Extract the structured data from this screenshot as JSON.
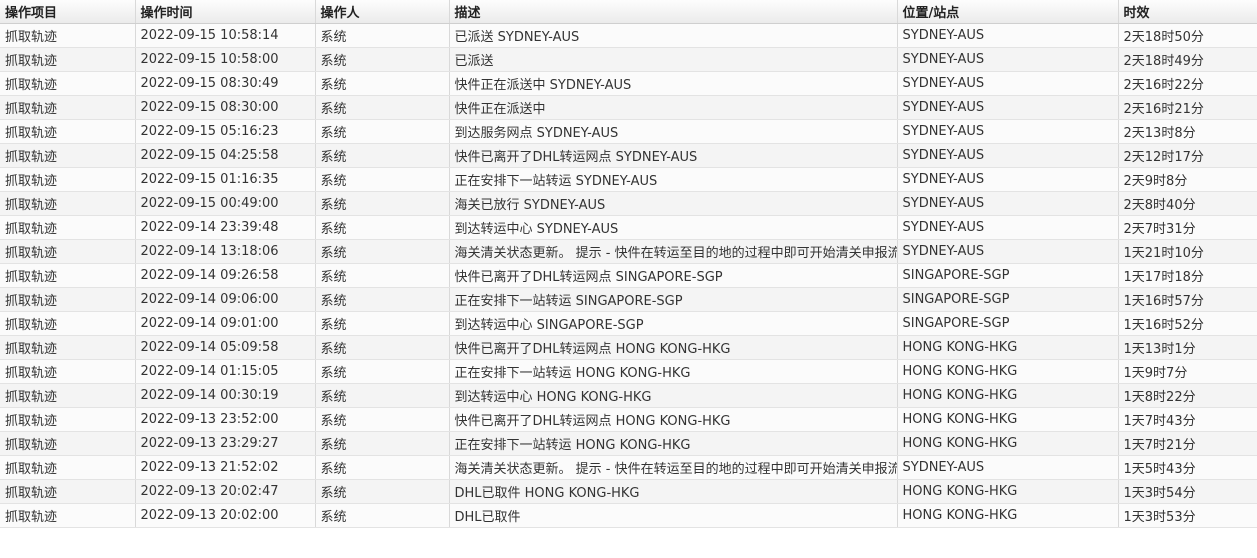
{
  "table": {
    "headers": [
      "操作项目",
      "操作时间",
      "操作人",
      "描述",
      "位置/站点",
      "时效"
    ],
    "rows": [
      [
        "抓取轨迹",
        "2022-09-15 10:58:14",
        "系统",
        "已派送 SYDNEY-AUS",
        "SYDNEY-AUS",
        "2天18时50分"
      ],
      [
        "抓取轨迹",
        "2022-09-15 10:58:00",
        "系统",
        "已派送",
        "SYDNEY-AUS",
        "2天18时49分"
      ],
      [
        "抓取轨迹",
        "2022-09-15 08:30:49",
        "系统",
        "快件正在派送中 SYDNEY-AUS",
        "SYDNEY-AUS",
        "2天16时22分"
      ],
      [
        "抓取轨迹",
        "2022-09-15 08:30:00",
        "系统",
        "快件正在派送中",
        "SYDNEY-AUS",
        "2天16时21分"
      ],
      [
        "抓取轨迹",
        "2022-09-15 05:16:23",
        "系统",
        "到达服务网点 SYDNEY-AUS",
        "SYDNEY-AUS",
        "2天13时8分"
      ],
      [
        "抓取轨迹",
        "2022-09-15 04:25:58",
        "系统",
        "快件已离开了DHL转运网点 SYDNEY-AUS",
        "SYDNEY-AUS",
        "2天12时17分"
      ],
      [
        "抓取轨迹",
        "2022-09-15 01:16:35",
        "系统",
        "正在安排下一站转运 SYDNEY-AUS",
        "SYDNEY-AUS",
        "2天9时8分"
      ],
      [
        "抓取轨迹",
        "2022-09-15 00:49:00",
        "系统",
        "海关已放行 SYDNEY-AUS",
        "SYDNEY-AUS",
        "2天8时40分"
      ],
      [
        "抓取轨迹",
        "2022-09-14 23:39:48",
        "系统",
        "到达转运中心 SYDNEY-AUS",
        "SYDNEY-AUS",
        "2天7时31分"
      ],
      [
        "抓取轨迹",
        "2022-09-14 13:18:06",
        "系统",
        "海关清关状态更新。 提示 - 快件在转运至目的地的过程中即可开始清关申报流程",
        "SYDNEY-AUS",
        "1天21时10分"
      ],
      [
        "抓取轨迹",
        "2022-09-14 09:26:58",
        "系统",
        "快件已离开了DHL转运网点 SINGAPORE-SGP",
        "SINGAPORE-SGP",
        "1天17时18分"
      ],
      [
        "抓取轨迹",
        "2022-09-14 09:06:00",
        "系统",
        "正在安排下一站转运 SINGAPORE-SGP",
        "SINGAPORE-SGP",
        "1天16时57分"
      ],
      [
        "抓取轨迹",
        "2022-09-14 09:01:00",
        "系统",
        "到达转运中心 SINGAPORE-SGP",
        "SINGAPORE-SGP",
        "1天16时52分"
      ],
      [
        "抓取轨迹",
        "2022-09-14 05:09:58",
        "系统",
        "快件已离开了DHL转运网点 HONG KONG-HKG",
        "HONG KONG-HKG",
        "1天13时1分"
      ],
      [
        "抓取轨迹",
        "2022-09-14 01:15:05",
        "系统",
        "正在安排下一站转运 HONG KONG-HKG",
        "HONG KONG-HKG",
        "1天9时7分"
      ],
      [
        "抓取轨迹",
        "2022-09-14 00:30:19",
        "系统",
        "到达转运中心 HONG KONG-HKG",
        "HONG KONG-HKG",
        "1天8时22分"
      ],
      [
        "抓取轨迹",
        "2022-09-13 23:52:00",
        "系统",
        "快件已离开了DHL转运网点 HONG KONG-HKG",
        "HONG KONG-HKG",
        "1天7时43分"
      ],
      [
        "抓取轨迹",
        "2022-09-13 23:29:27",
        "系统",
        "正在安排下一站转运 HONG KONG-HKG",
        "HONG KONG-HKG",
        "1天7时21分"
      ],
      [
        "抓取轨迹",
        "2022-09-13 21:52:02",
        "系统",
        "海关清关状态更新。 提示 - 快件在转运至目的地的过程中即可开始清关申报流程",
        "SYDNEY-AUS",
        "1天5时43分"
      ],
      [
        "抓取轨迹",
        "2022-09-13 20:02:47",
        "系统",
        "DHL已取件 HONG KONG-HKG",
        "HONG KONG-HKG",
        "1天3时54分"
      ],
      [
        "抓取轨迹",
        "2022-09-13 20:02:00",
        "系统",
        "DHL已取件",
        "HONG KONG-HKG",
        "1天3时53分"
      ]
    ]
  }
}
